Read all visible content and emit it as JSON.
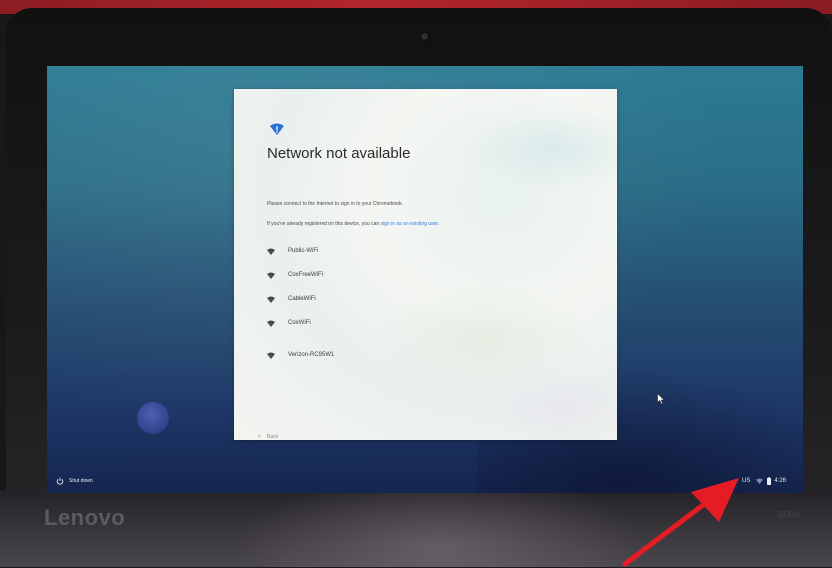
{
  "device": {
    "brand": "Lenovo",
    "model": "300e"
  },
  "dialog": {
    "title": "Network not available",
    "message": "Please connect to the Internet to sign in to your Chromebook.",
    "registered_text": "If you've already registered on this device, you can ",
    "registered_link": "sign in as an existing user",
    "registered_suffix": ".",
    "networks": [
      {
        "name": "Public-WiFi",
        "icon": "wifi-icon"
      },
      {
        "name": "CoxFreeWiFi",
        "icon": "wifi-icon"
      },
      {
        "name": "CableWiFi",
        "icon": "wifi-icon"
      },
      {
        "name": "CoxWiFi",
        "icon": "wifi-icon"
      },
      {
        "name": "Verizon-RC95W1",
        "icon": "wifi-icon"
      }
    ],
    "back_label": "Back",
    "accent_color": "#3b78e7"
  },
  "shelf": {
    "shutdown_label": "Shut down",
    "ime": "US",
    "time": "4:26"
  },
  "annotation": {
    "arrow_color": "#e51c23"
  }
}
